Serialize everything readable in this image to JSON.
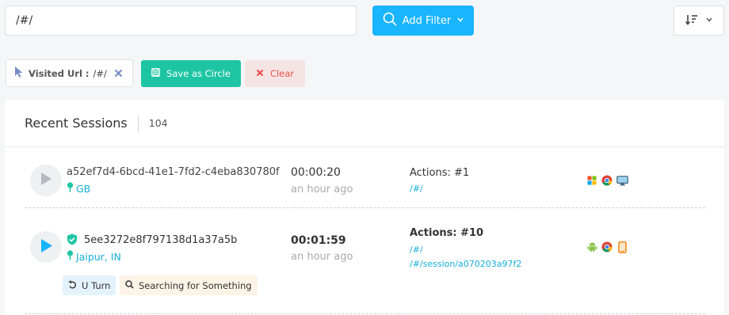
{
  "search": {
    "value": "/#/"
  },
  "toolbar": {
    "add_filter_label": "Add Filter",
    "search_icon": "search-icon",
    "sort_icon": "sort-icon"
  },
  "filter_chip": {
    "label": "Visited Url :",
    "value": "/#/",
    "icon": "cursor-pointer-icon"
  },
  "actions": {
    "save_label": "Save as Circle",
    "clear_label": "Clear"
  },
  "sessions": {
    "title": "Recent Sessions",
    "count": "104",
    "rows": [
      {
        "id": "a52ef7d4-6bcd-41e1-7fd2-c4eba830780f",
        "location": "GB",
        "duration": "00:00:20",
        "ago": "an hour ago",
        "actions": "Actions: #1",
        "urls": [
          "/#/"
        ],
        "play_color": "#b6babf",
        "icons": [
          "windows-icon",
          "chrome-icon",
          "desktop-icon"
        ]
      },
      {
        "id": "5ee3272e8f797138d1a37a5b",
        "location": "Jaipur, IN",
        "duration": "00:01:59",
        "ago": "an hour ago",
        "actions": "Actions: #10",
        "urls": [
          "/#/",
          "/#/session/a070203a97f2"
        ],
        "play_color": "#19b5fe",
        "verified": true,
        "icons": [
          "android-icon",
          "chrome-icon",
          "mobile-icon"
        ],
        "tags": [
          "U Turn",
          "Searching for Something"
        ]
      }
    ]
  },
  "colors": {
    "accent": "#19b5fe",
    "teal": "#1ec5a4",
    "danger": "#e8504d",
    "link": "#16b0d9"
  }
}
